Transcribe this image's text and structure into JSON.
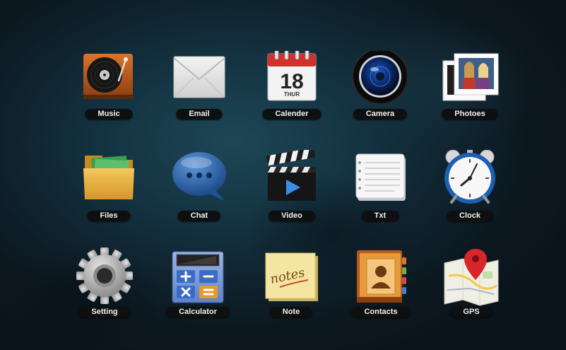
{
  "launcher": {
    "apps": [
      {
        "label": "Music",
        "icon": "music-turntable-icon"
      },
      {
        "label": "Email",
        "icon": "envelope-icon"
      },
      {
        "label": "Calender",
        "icon": "calendar-icon",
        "day": "18",
        "weekday": "THUR"
      },
      {
        "label": "Camera",
        "icon": "camera-lens-icon"
      },
      {
        "label": "Photoes",
        "icon": "photos-icon"
      },
      {
        "label": "Files",
        "icon": "folder-icon"
      },
      {
        "label": "Chat",
        "icon": "chat-bubble-icon"
      },
      {
        "label": "Video",
        "icon": "clapperboard-icon"
      },
      {
        "label": "Txt",
        "icon": "notepad-icon"
      },
      {
        "label": "Clock",
        "icon": "alarm-clock-icon"
      },
      {
        "label": "Setting",
        "icon": "gear-icon"
      },
      {
        "label": "Calculator",
        "icon": "calculator-icon"
      },
      {
        "label": "Note",
        "icon": "sticky-note-icon",
        "note_text": "notes"
      },
      {
        "label": "Contacts",
        "icon": "address-book-icon"
      },
      {
        "label": "GPS",
        "icon": "map-pin-icon"
      }
    ]
  },
  "colors": {
    "background": "#153645",
    "label_bg": "#0d0f11",
    "label_text": "#f1f1f1"
  }
}
